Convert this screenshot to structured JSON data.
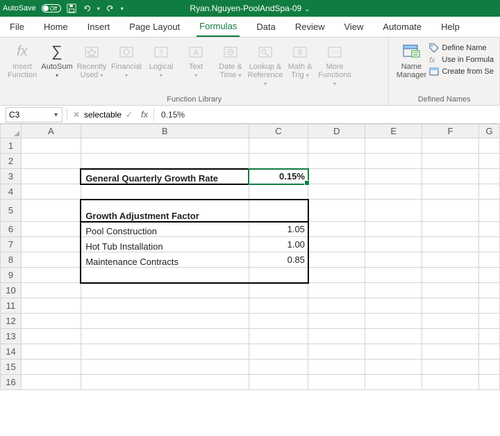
{
  "titlebar": {
    "autosave": "AutoSave",
    "autosave_state": "Off",
    "filename": "Ryan.Nguyen-PoolAndSpa-09"
  },
  "menu": {
    "file": "File",
    "home": "Home",
    "insert": "Insert",
    "pagelayout": "Page Layout",
    "formulas": "Formulas",
    "data": "Data",
    "review": "Review",
    "view": "View",
    "automate": "Automate",
    "help": "Help"
  },
  "ribbon": {
    "insert_function": "Insert\nFunction",
    "autosum": "AutoSum",
    "recently_used": "Recently\nUsed",
    "financial": "Financial",
    "logical": "Logical",
    "text": "Text",
    "date_time": "Date &\nTime",
    "lookup_ref": "Lookup &\nReference",
    "math_trig": "Math &\nTrig",
    "more_fn": "More\nFunctions",
    "group_fnlib": "Function Library",
    "name_manager": "Name\nManager",
    "define_name": "Define Name",
    "use_in_formula": "Use in Formula",
    "create_from": "Create from Se",
    "group_defnames": "Defined Names"
  },
  "formula_bar": {
    "namebox": "C3",
    "value": "0.15%"
  },
  "headers": {
    "cols": [
      "A",
      "B",
      "C",
      "D",
      "E",
      "F",
      "G"
    ],
    "rows": [
      "1",
      "2",
      "3",
      "4",
      "5",
      "6",
      "7",
      "8",
      "9",
      "10",
      "11",
      "12",
      "13",
      "14",
      "15",
      "16"
    ]
  },
  "cells": {
    "B3": "General Quarterly Growth Rate",
    "C3": "0.15%",
    "B5": "Growth Adjustment Factor",
    "B6": "Pool Construction",
    "C6": "1.05",
    "B7": "Hot Tub Installation",
    "C7": "1.00",
    "B8": "Maintenance Contracts",
    "C8": "0.85"
  }
}
